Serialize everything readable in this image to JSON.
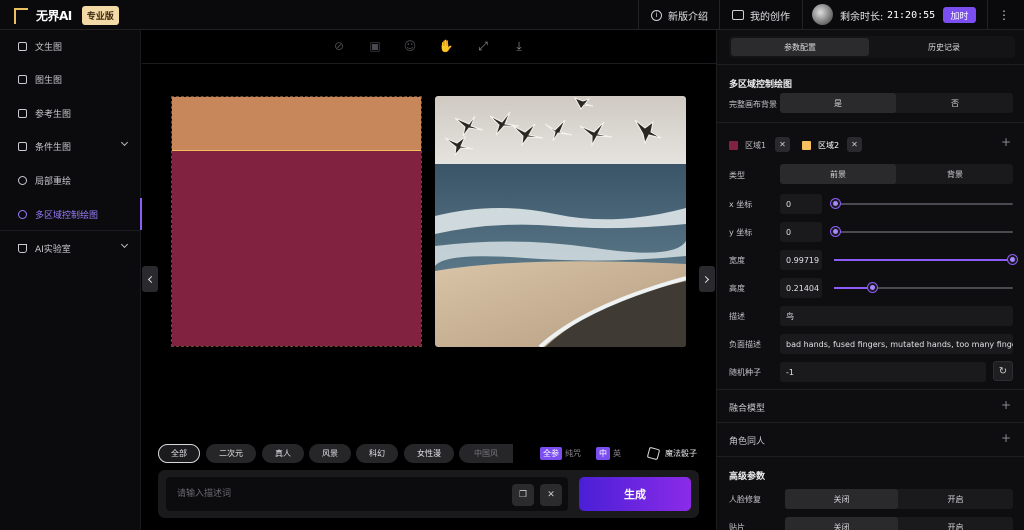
{
  "topbar": {
    "logo_text": "无界AI",
    "pro_badge": "专业版",
    "whats_new": "新版介绍",
    "my_works": "我的创作",
    "remaining_label": "剩余时长:",
    "remaining_time": "21:20:55",
    "add_time": "加时"
  },
  "sidebar": {
    "items": [
      {
        "label": "文生图"
      },
      {
        "label": "图生图"
      },
      {
        "label": "参考生图"
      },
      {
        "label": "条件生图"
      },
      {
        "label": "局部重绘"
      },
      {
        "label": "多区域控制绘图"
      },
      {
        "label": "AI实验室"
      }
    ]
  },
  "canvas": {
    "styles": [
      "全部",
      "二次元",
      "真人",
      "风景",
      "科幻",
      "女性漫",
      "中国风"
    ],
    "tag_all": "全参",
    "tag_all_suffix": "纯咒",
    "tag_cn": "中",
    "tag_en": "英",
    "dice_label": "魔法骰子",
    "prompt_placeholder": "请输入描述词",
    "generate": "生成",
    "region_colors": {
      "region1": "#812340",
      "region2": "#c8875a"
    }
  },
  "panel": {
    "tab_params": "参数配置",
    "tab_history": "历史记录",
    "section_title": "多区域控制绘图",
    "full_bg_label": "完整画布背景",
    "full_bg_yes": "是",
    "full_bg_no": "否",
    "region1": "区域1",
    "region2": "区域2",
    "type_label": "类型",
    "type_fg": "前景",
    "type_bg": "背景",
    "x_label": "x 坐标",
    "x_value": "0",
    "y_label": "y 坐标",
    "y_value": "0",
    "width_label": "宽度",
    "width_value": "0.99719",
    "height_label": "高度",
    "height_value": "0.21404",
    "desc_label": "描述",
    "desc_value": "鸟",
    "neg_label": "负面描述",
    "neg_value": "bad hands, fused fingers, mutated hands, too many fingers",
    "seed_label": "随机种子",
    "seed_value": "-1",
    "merge_model": "融合模型",
    "character": "角色同人",
    "advanced": "高级参数",
    "face_fix": "人脸修复",
    "face_off": "关闭",
    "face_on": "开启",
    "tile_label": "贴片",
    "tile_off": "关闭",
    "tile_on": "开启"
  }
}
